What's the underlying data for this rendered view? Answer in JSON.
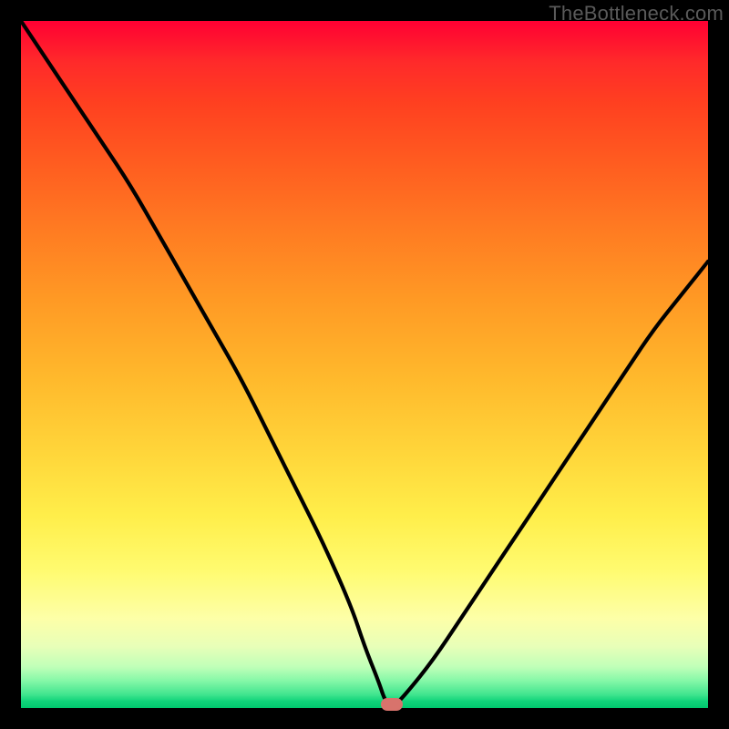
{
  "watermark": "TheBottleneck.com",
  "colors": {
    "line": "#000000",
    "marker": "#d8736c",
    "frame": "#000000"
  },
  "chart_data": {
    "type": "line",
    "title": "",
    "xlabel": "",
    "ylabel": "",
    "xlim": [
      0,
      100
    ],
    "ylim": [
      0,
      100
    ],
    "grid": false,
    "legend": false,
    "series": [
      {
        "name": "bottleneck-curve",
        "x": [
          0,
          4,
          8,
          12,
          16,
          20,
          24,
          28,
          32,
          36,
          40,
          44,
          48,
          50,
          52,
          53,
          54,
          56,
          60,
          64,
          68,
          72,
          76,
          80,
          84,
          88,
          92,
          96,
          100
        ],
        "y": [
          100,
          94,
          88,
          82,
          76,
          69,
          62,
          55,
          48,
          40,
          32,
          24,
          15,
          9,
          4,
          1,
          0,
          2,
          7,
          13,
          19,
          25,
          31,
          37,
          43,
          49,
          55,
          60,
          65
        ]
      }
    ],
    "marker": {
      "x": 54,
      "y": 0
    }
  }
}
